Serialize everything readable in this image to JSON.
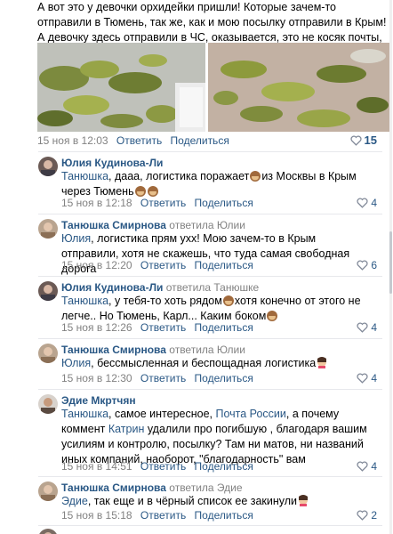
{
  "post": {
    "text": "А вот это у девочки орхидейки пришли! Которые зачем-то отправили в Тюмень, так же, как и мою посылку отправили в Крым! А девочку здесь отправили в ЧС, оказывается, это не косяк почты, а спам!",
    "date": "15 ноя в 12:03",
    "reply_label": "Ответить",
    "share_label": "Поделиться",
    "likes": "15"
  },
  "comments": [
    {
      "name": "Юлия Кудинова-Ли",
      "replied": "",
      "reply_to": "",
      "mention": "Танюшка",
      "text_a": ", дааа, логистика поражает",
      "text_b": "из Москвы в Крым через Тюмень",
      "text_c": "",
      "date": "15 ноя в 12:18",
      "reply_label": "Ответить",
      "share_label": "Поделиться",
      "likes": "4"
    },
    {
      "name": "Танюшка Смирнова",
      "replied": "ответила",
      "reply_to": "Юлии",
      "mention": "Юлия",
      "text_a": ", логистика прям ухх! Мою зачем-то в Крым отправили, хотя не скажешь, что туда самая свободная дорога",
      "text_b": "",
      "text_c": "",
      "date": "15 ноя в 12:20",
      "reply_label": "Ответить",
      "share_label": "Поделиться",
      "likes": "6"
    },
    {
      "name": "Юлия Кудинова-Ли",
      "replied": "ответила",
      "reply_to": "Танюшке",
      "mention": "Танюшка",
      "text_a": ", у тебя-то хоть рядом",
      "text_b": "хотя конечно от этого не легче.. Но Тюмень, Карл... Каким боком",
      "text_c": "",
      "date": "15 ноя в 12:26",
      "reply_label": "Ответить",
      "share_label": "Поделиться",
      "likes": "4"
    },
    {
      "name": "Танюшка Смирнова",
      "replied": "ответила",
      "reply_to": "Юлии",
      "mention": "Юлия",
      "text_a": ", бессмысленная и беспощадная логистика",
      "text_b": "",
      "text_c": "",
      "date": "15 ноя в 12:30",
      "reply_label": "Ответить",
      "share_label": "Поделиться",
      "likes": "4"
    },
    {
      "name": "Эдие Мкртчян",
      "replied": "",
      "reply_to": "",
      "mention": "Танюшка",
      "text_a": ", самое интересное,",
      "mention2": "Почта России",
      "text_b": ", а почему коммент",
      "mention3": "Катрин",
      "text_c": "удалили про погибшую , благодаря вашим усилиям и контролю, посылку? Там ни матов, ни названий иных компаний, наоборот, \"благодарность\" вам",
      "date": "15 ноя в 14:51",
      "reply_label": "Ответить",
      "share_label": "Поделиться",
      "likes": "4"
    },
    {
      "name": "Танюшка Смирнова",
      "replied": "ответила",
      "reply_to": "Эдие",
      "mention": "Эдие",
      "text_a": ", так еще и в чёрный список ее закинули",
      "text_b": "",
      "text_c": "",
      "date": "15 ноя в 15:18",
      "reply_label": "Ответить",
      "share_label": "Поделиться",
      "likes": "2"
    }
  ],
  "colors": {
    "link": "#2a5885",
    "meta": "#828282",
    "divider": "#e7e8ec"
  },
  "icons": {
    "like": "heart-icon",
    "monkey": "see-no-evil-monkey-emoji",
    "facepalm": "facepalm-emoji"
  }
}
